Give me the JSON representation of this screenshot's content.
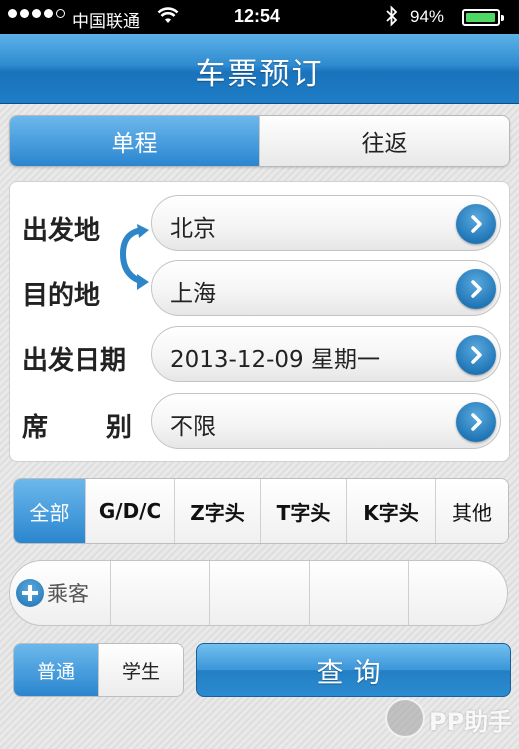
{
  "status_bar": {
    "carrier": "中国联通",
    "time": "12:54",
    "battery": "94%"
  },
  "header": {
    "title": "车票预订"
  },
  "trip_type": {
    "options": [
      "单程",
      "往返"
    ],
    "selected": "单程"
  },
  "form": {
    "departure_label": "出发地",
    "departure_value": "北京",
    "destination_label": "目的地",
    "destination_value": "上海",
    "date_label": "出发日期",
    "date_value": "2013-12-09 星期一",
    "seat_label_1": "席",
    "seat_label_2": "别",
    "seat_value": "不限"
  },
  "train_types": {
    "options": [
      "全部",
      "G/D/C",
      "Z字头",
      "T字头",
      "K字头",
      "其他"
    ],
    "selected": "全部"
  },
  "passengers": {
    "add_label": "乘客"
  },
  "ticket_type": {
    "options": [
      "普通",
      "学生"
    ],
    "selected": "普通"
  },
  "query_button": "查询",
  "watermark": "PP助手",
  "colors": {
    "accent_blue": "#2a86cf",
    "header_blue": "#1e7ec5"
  }
}
